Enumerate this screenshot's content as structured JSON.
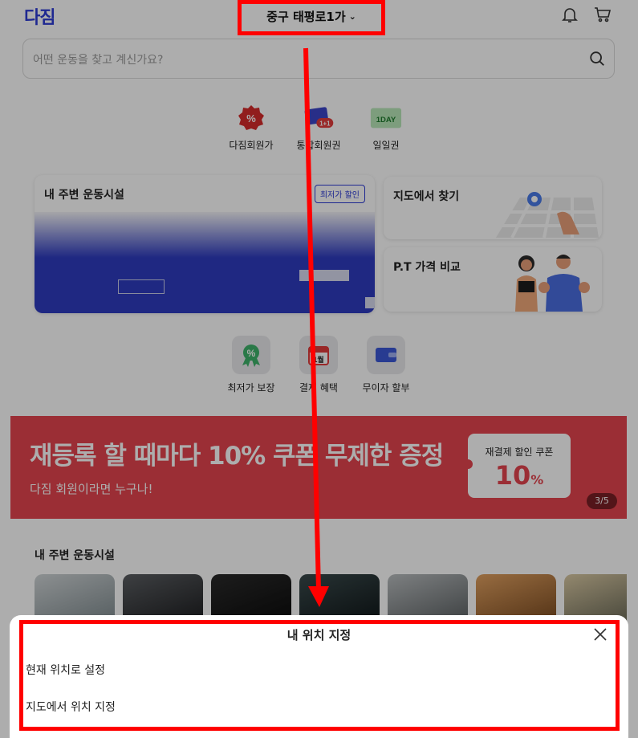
{
  "header": {
    "logo": "다짐",
    "location": "중구 태평로1가"
  },
  "search": {
    "placeholder": "어떤 운동을 찾고 계신가요?"
  },
  "categories": [
    {
      "label": "다짐회원가",
      "icon": "percent-badge-icon"
    },
    {
      "label": "통합회원권",
      "icon": "membership-card-icon",
      "badge": "1+1"
    },
    {
      "label": "일일권",
      "icon": "one-day-ticket-icon",
      "badge": "1DAY"
    }
  ],
  "facilities_card": {
    "title": "내 주변 운동시설",
    "badge": "최저가 할인"
  },
  "map_card": {
    "title": "지도에서 찾기"
  },
  "pt_card": {
    "title": "P.T 가격 비교"
  },
  "benefits": [
    {
      "label": "최저가 보장",
      "icon": "percent-ribbon-icon"
    },
    {
      "label": "결제 혜택",
      "icon": "calendar-icon",
      "badge": "1월"
    },
    {
      "label": "무이자 할부",
      "icon": "wallet-icon"
    }
  ],
  "banner": {
    "headline": "재등록 할 때마다 10% 쿠폰 무제한 증정",
    "subtext": "다짐 회원이라면 누구나!",
    "coupon_title": "재결제 할인 쿠폰",
    "coupon_value": "10",
    "coupon_unit": "%",
    "pager": "3/5",
    "color": "#e5454f"
  },
  "nearby": {
    "title": "내 주변 운동시설"
  },
  "sheet": {
    "title": "내 위치 지정",
    "option_current": "현재 위치로 설정",
    "option_map": "지도에서 위치 지정"
  },
  "colors": {
    "accent": "#2d3bd6",
    "highlight": "#ff0000"
  }
}
